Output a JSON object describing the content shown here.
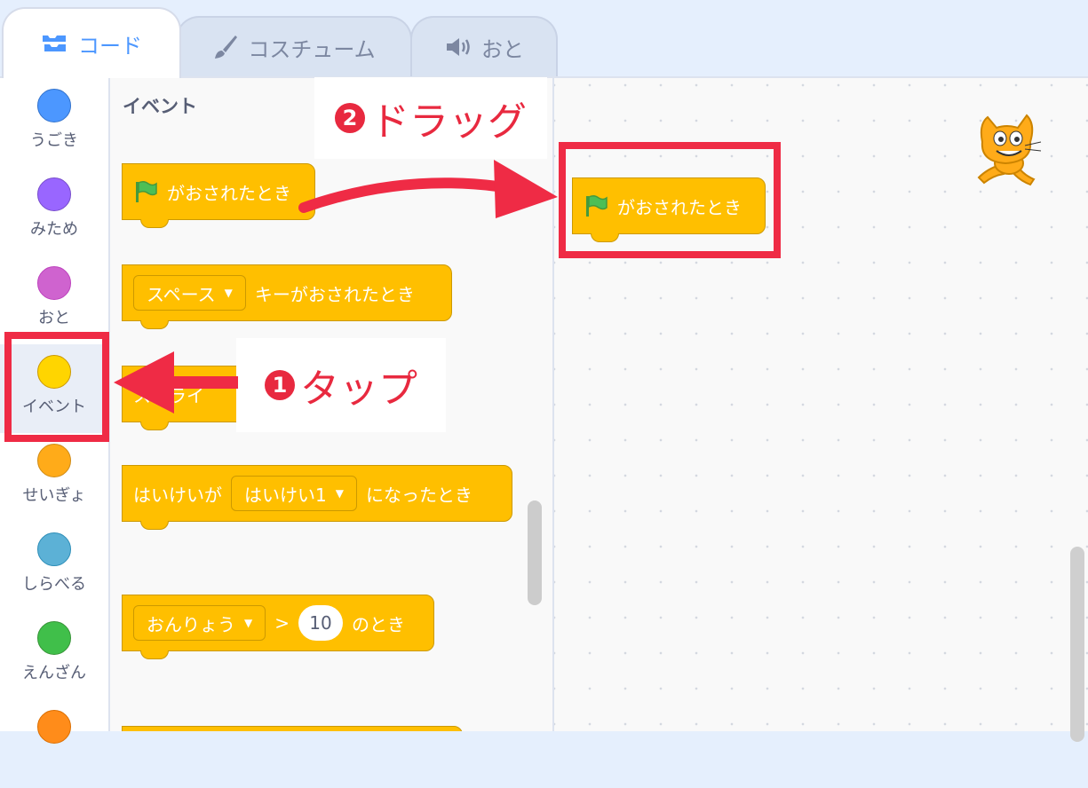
{
  "tabs": {
    "code": "コード",
    "costume": "コスチューム",
    "sound": "おと"
  },
  "categories": [
    {
      "label": "うごき",
      "color": "#4c97ff"
    },
    {
      "label": "みため",
      "color": "#9966ff"
    },
    {
      "label": "おと",
      "color": "#cf63cf"
    },
    {
      "label": "イベント",
      "color": "#ffd500"
    },
    {
      "label": "せいぎょ",
      "color": "#ffab19"
    },
    {
      "label": "しらべる",
      "color": "#5cb1d6"
    },
    {
      "label": "えんざん",
      "color": "#40bf4a"
    },
    {
      "label": "",
      "color": "#ff8c1a"
    }
  ],
  "palette": {
    "heading": "イベント",
    "blocks": {
      "flag_clicked": "がおされたとき",
      "key_pressed_dropdown": "スペース",
      "key_pressed_text": "キーがおされたとき",
      "sprite_clicked_partial": "スプライ",
      "backdrop_text_prefix": "はいけいが",
      "backdrop_dropdown": "はいけい1",
      "backdrop_text_suffix": "になったとき",
      "loudness_dropdown": "おんりょう",
      "loudness_op": ">",
      "loudness_value": "10",
      "loudness_suffix": "のとき"
    }
  },
  "workspace": {
    "flag_block_label": "がおされたとき"
  },
  "annotations": {
    "step1_number": "1",
    "step1_label": "タップ",
    "step2_number": "2",
    "step2_label": "ドラッグ",
    "highlight_color": "#ef2b45"
  }
}
